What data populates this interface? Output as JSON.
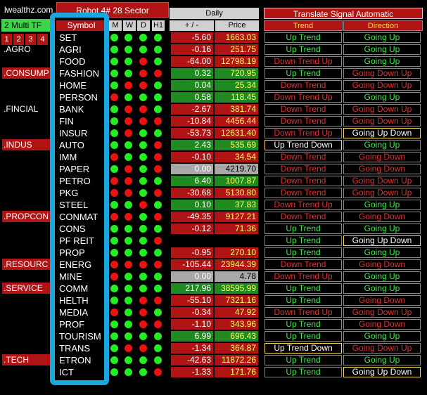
{
  "header": {
    "brand": "lwealthz.com",
    "robot_title": "Robot 4# 28 Sector",
    "multi_tf": "2 Multi TF",
    "tf_buttons": [
      "1",
      "2",
      "3",
      "4"
    ],
    "daily": "Daily",
    "translate_signal": "Translate Signal Automatic"
  },
  "columns": {
    "symbol": "Symbol",
    "m": "M",
    "w": "W",
    "d": "D",
    "h1": "H1",
    "change": "+ / -",
    "price": "Price",
    "trend": "Trend",
    "direction": "Direction"
  },
  "sectors": [
    {
      "label": ".AGRO",
      "row": 1,
      "tag": false
    },
    {
      "label": ".CONSUMP",
      "row": 3,
      "tag": true
    },
    {
      "label": ".FINCIAL",
      "row": 6,
      "tag": false
    },
    {
      "label": ".INDUS",
      "row": 9,
      "tag": true
    },
    {
      "label": ".PROPCON",
      "row": 15,
      "tag": true
    },
    {
      "label": ".RESOURC",
      "row": 19,
      "tag": true
    },
    {
      "label": ".SERVICE",
      "row": 21,
      "tag": true
    },
    {
      "label": ".TECH",
      "row": 27,
      "tag": true
    }
  ],
  "colors": {
    "green_dot": "#22ee22",
    "red_dot": "#ee1111",
    "green_cell": "#1f8a1f",
    "red_cell": "#b01414",
    "gray_cell": "#a8a8a8",
    "price_text_up": "#ffff66",
    "trend_up_text": "#3fe84a",
    "trend_down_text": "#e03030",
    "warn_text": "#ffffff"
  },
  "rows": [
    {
      "symbol": "SET",
      "dots": [
        "g",
        "g",
        "g",
        "g"
      ],
      "change": "-5.60",
      "price": "1663.03",
      "tone": "red",
      "trend": "Up Trend",
      "trend_tone": "up",
      "direction": "Going Up",
      "dir_tone": "up"
    },
    {
      "symbol": "AGRI",
      "dots": [
        "g",
        "g",
        "g",
        "g"
      ],
      "change": "-0.16",
      "price": "251.75",
      "tone": "red",
      "trend": "Up Trend",
      "trend_tone": "up",
      "direction": "Going Up",
      "dir_tone": "up"
    },
    {
      "symbol": "FOOD",
      "dots": [
        "g",
        "g",
        "r",
        "g"
      ],
      "change": "-64.00",
      "price": "12798.19",
      "tone": "red",
      "trend": "Down Trend Up",
      "trend_tone": "down",
      "direction": "Going Up",
      "dir_tone": "up"
    },
    {
      "symbol": "FASHION",
      "dots": [
        "g",
        "g",
        "r",
        "r"
      ],
      "change": "0.32",
      "price": "720.95",
      "tone": "green",
      "trend": "Up Trend",
      "trend_tone": "up",
      "direction": "Going Down Up",
      "dir_tone": "down"
    },
    {
      "symbol": "HOME",
      "dots": [
        "g",
        "r",
        "r",
        "g"
      ],
      "change": "0.04",
      "price": "25.34",
      "tone": "green",
      "trend": "Down Trend",
      "trend_tone": "down",
      "direction": "Going Down Up",
      "dir_tone": "down"
    },
    {
      "symbol": "PERSON",
      "dots": [
        "r",
        "g",
        "g",
        "g"
      ],
      "change": "0.58",
      "price": "118.45",
      "tone": "green",
      "trend": "Down Trend Up",
      "trend_tone": "down",
      "direction": "Going Up",
      "dir_tone": "up"
    },
    {
      "symbol": "BANK",
      "dots": [
        "g",
        "r",
        "r",
        "g"
      ],
      "change": "-2.67",
      "price": "381.74",
      "tone": "red",
      "trend": "Down Trend",
      "trend_tone": "down",
      "direction": "Going Down Up",
      "dir_tone": "down"
    },
    {
      "symbol": "FIN",
      "dots": [
        "g",
        "r",
        "r",
        "r"
      ],
      "change": "-10.84",
      "price": "4456.44",
      "tone": "red",
      "trend": "Down Trend",
      "trend_tone": "down",
      "direction": "Going Down Up",
      "dir_tone": "down"
    },
    {
      "symbol": "INSUR",
      "dots": [
        "g",
        "r",
        "g",
        "g"
      ],
      "change": "-53.73",
      "price": "12631.40",
      "tone": "red",
      "trend": "Down Trend Up",
      "trend_tone": "down",
      "direction": "Going Up Down",
      "dir_tone": "warn"
    },
    {
      "symbol": "AUTO",
      "dots": [
        "g",
        "g",
        "g",
        "r"
      ],
      "change": "2.43",
      "price": "535.69",
      "tone": "green",
      "trend": "Up Trend Down",
      "trend_tone": "warn",
      "direction": "Going Up",
      "dir_tone": "up"
    },
    {
      "symbol": "IMM",
      "dots": [
        "r",
        "g",
        "g",
        "r"
      ],
      "change": "-0.10",
      "price": "34.54",
      "tone": "red",
      "trend": "Down Trend",
      "trend_tone": "down",
      "direction": "Going Down",
      "dir_tone": "down"
    },
    {
      "symbol": "PAPER",
      "dots": [
        "g",
        "r",
        "g",
        "r"
      ],
      "change": "0.00",
      "price": "4219.70",
      "tone": "gray",
      "trend": "Down Trend",
      "trend_tone": "down",
      "direction": "Going Down",
      "dir_tone": "down"
    },
    {
      "symbol": "PETRO",
      "dots": [
        "r",
        "r",
        "g",
        "g"
      ],
      "change": "6.40",
      "price": "1007.87",
      "tone": "green",
      "trend": "Down Trend",
      "trend_tone": "down",
      "direction": "Going Down Up",
      "dir_tone": "down"
    },
    {
      "symbol": "PKG",
      "dots": [
        "r",
        "r",
        "g",
        "r"
      ],
      "change": "-30.68",
      "price": "5130.80",
      "tone": "red",
      "trend": "Down Trend",
      "trend_tone": "down",
      "direction": "Going Down Up",
      "dir_tone": "down"
    },
    {
      "symbol": "STEEL",
      "dots": [
        "g",
        "g",
        "r",
        "g"
      ],
      "change": "0.10",
      "price": "37.83",
      "tone": "green",
      "trend": "Down Trend Up",
      "trend_tone": "down",
      "direction": "Going Up",
      "dir_tone": "up"
    },
    {
      "symbol": "CONMAT",
      "dots": [
        "r",
        "r",
        "g",
        "r"
      ],
      "change": "-49.35",
      "price": "9127.21",
      "tone": "red",
      "trend": "Down Trend",
      "trend_tone": "down",
      "direction": "Going Down",
      "dir_tone": "down"
    },
    {
      "symbol": "CONS",
      "dots": [
        "g",
        "g",
        "g",
        "g"
      ],
      "change": "-0.12",
      "price": "71.36",
      "tone": "red",
      "trend": "Up Trend",
      "trend_tone": "up",
      "direction": "Going Up",
      "dir_tone": "up"
    },
    {
      "symbol": "PF REIT",
      "dots": [
        "g",
        "g",
        "g",
        "r"
      ],
      "change": "",
      "price": "",
      "tone": "none",
      "trend": "Up Trend",
      "trend_tone": "up",
      "direction": "Going Up Down",
      "dir_tone": "warn"
    },
    {
      "symbol": "PROP",
      "dots": [
        "g",
        "g",
        "g",
        "g"
      ],
      "change": "-0.95",
      "price": "270.10",
      "tone": "red",
      "trend": "Up Trend",
      "trend_tone": "up",
      "direction": "Going Up",
      "dir_tone": "up"
    },
    {
      "symbol": "ENERG",
      "dots": [
        "r",
        "r",
        "r",
        "r"
      ],
      "change": "-105.44",
      "price": "23944.39",
      "tone": "red",
      "trend": "Down Trend",
      "trend_tone": "down",
      "direction": "Going Down",
      "dir_tone": "down"
    },
    {
      "symbol": "MINE",
      "dots": [
        "r",
        "g",
        "g",
        "g"
      ],
      "change": "0.00",
      "price": "4.78",
      "tone": "gray",
      "trend": "Down Trend Up",
      "trend_tone": "down",
      "direction": "Going Up",
      "dir_tone": "up"
    },
    {
      "symbol": "COMM",
      "dots": [
        "g",
        "g",
        "g",
        "g"
      ],
      "change": "217.96",
      "price": "38595.99",
      "tone": "green",
      "trend": "Up Trend",
      "trend_tone": "up",
      "direction": "Going Up",
      "dir_tone": "up"
    },
    {
      "symbol": "HELTH",
      "dots": [
        "g",
        "g",
        "r",
        "r"
      ],
      "change": "-55.10",
      "price": "7321.16",
      "tone": "red",
      "trend": "Up Trend",
      "trend_tone": "up",
      "direction": "Going Down",
      "dir_tone": "down"
    },
    {
      "symbol": "MEDIA",
      "dots": [
        "r",
        "g",
        "r",
        "g"
      ],
      "change": "-0.34",
      "price": "47.92",
      "tone": "red",
      "trend": "Down Trend Up",
      "trend_tone": "down",
      "direction": "Going Down Up",
      "dir_tone": "down"
    },
    {
      "symbol": "PROF",
      "dots": [
        "g",
        "g",
        "r",
        "r"
      ],
      "change": "-1.10",
      "price": "343.96",
      "tone": "red",
      "trend": "Up Trend",
      "trend_tone": "up",
      "direction": "Going Down",
      "dir_tone": "down"
    },
    {
      "symbol": "TOURISM",
      "dots": [
        "g",
        "g",
        "g",
        "g"
      ],
      "change": "6.99",
      "price": "696.43",
      "tone": "green",
      "trend": "Up Trend",
      "trend_tone": "up",
      "direction": "Going Up",
      "dir_tone": "up"
    },
    {
      "symbol": "TRANS",
      "dots": [
        "g",
        "r",
        "r",
        "g"
      ],
      "change": "-1.34",
      "price": "364.87",
      "tone": "red",
      "trend": "Up Trend Down",
      "trend_tone": "warn",
      "direction": "Going Down Up",
      "dir_tone": "down"
    },
    {
      "symbol": "ETRON",
      "dots": [
        "g",
        "g",
        "g",
        "g"
      ],
      "change": "-42.63",
      "price": "11872.26",
      "tone": "red",
      "trend": "Up Trend",
      "trend_tone": "up",
      "direction": "Going Up",
      "dir_tone": "up"
    },
    {
      "symbol": "ICT",
      "dots": [
        "g",
        "g",
        "g",
        "r"
      ],
      "change": "-1.33",
      "price": "171.76",
      "tone": "red",
      "trend": "Up Trend",
      "trend_tone": "up",
      "direction": "Going Up Down",
      "dir_tone": "warn"
    }
  ]
}
